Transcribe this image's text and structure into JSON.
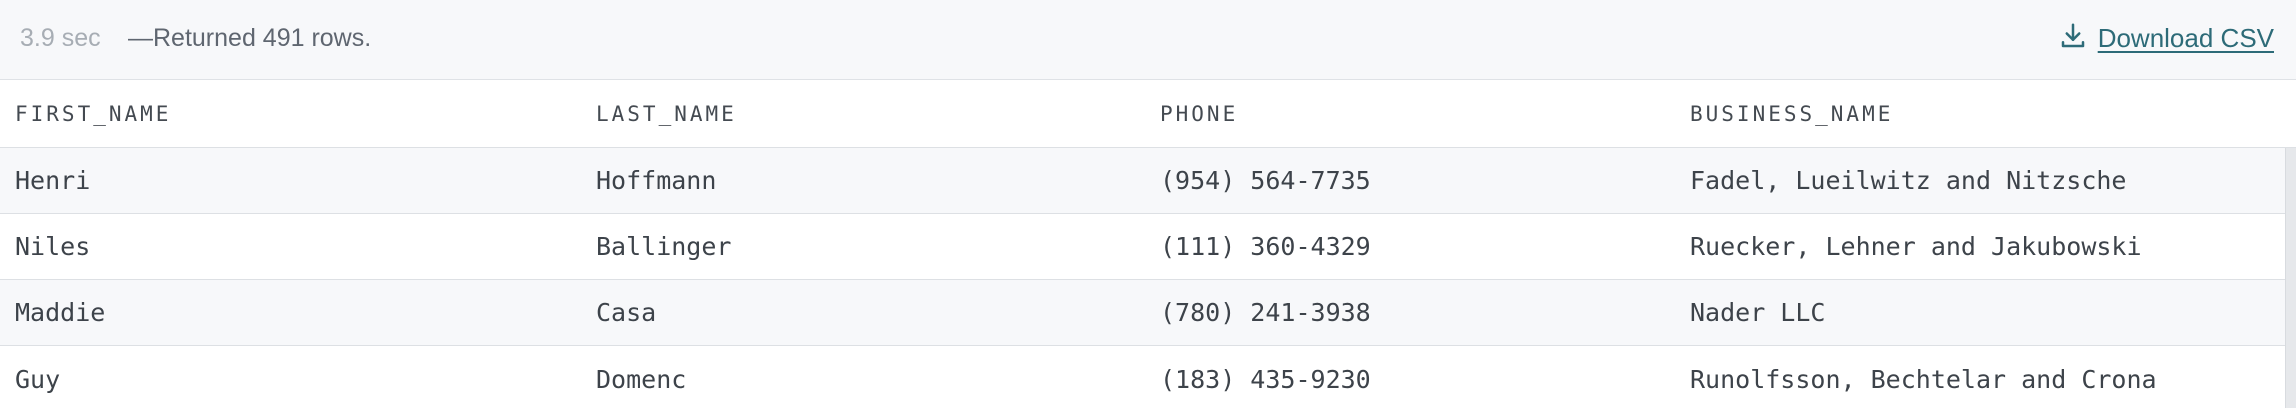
{
  "status": {
    "timing": "3.9 sec",
    "rows_returned": "—Returned 491 rows."
  },
  "download": {
    "label": "Download CSV",
    "icon": "download-icon"
  },
  "table": {
    "columns": [
      "FIRST_NAME",
      "LAST_NAME",
      "PHONE",
      "BUSINESS_NAME"
    ],
    "rows": [
      [
        "Henri",
        "Hoffmann",
        "(954) 564-7735",
        "Fadel, Lueilwitz and Nitzsche"
      ],
      [
        "Niles",
        "Ballinger",
        "(111) 360-4329",
        "Ruecker, Lehner and Jakubowski"
      ],
      [
        "Maddie",
        "Casa",
        "(780) 241-3938",
        "Nader LLC"
      ],
      [
        "Guy",
        "Domenc",
        "(183) 435-9230",
        "Runolfsson, Bechtelar and Crona"
      ]
    ]
  },
  "colors": {
    "link": "#2d6b78",
    "stripe": "#f7f8fa",
    "border": "#dde0e4"
  }
}
